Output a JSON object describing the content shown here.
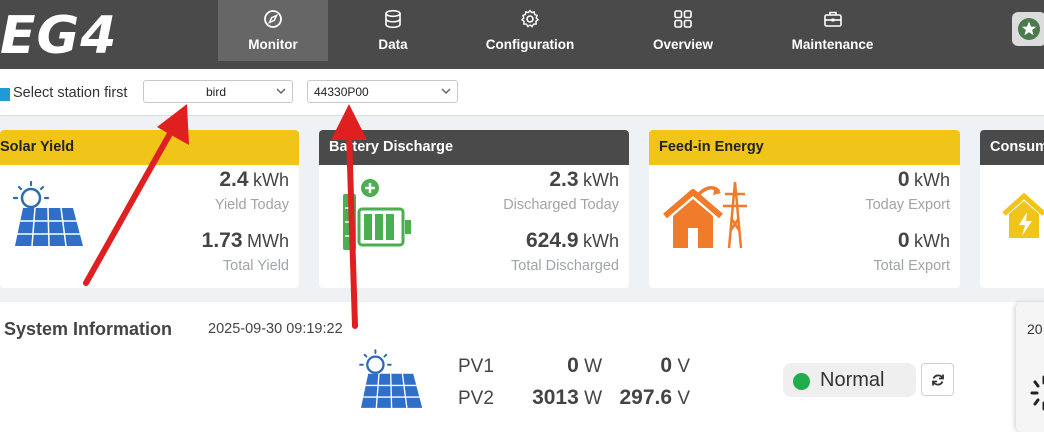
{
  "brand": {
    "logo_text": "EG4"
  },
  "nav": {
    "items": [
      {
        "label": "Monitor",
        "icon": "compass-icon",
        "active": true
      },
      {
        "label": "Data",
        "icon": "database-icon"
      },
      {
        "label": "Configuration",
        "icon": "gear-icon"
      },
      {
        "label": "Overview",
        "icon": "grid-icon"
      },
      {
        "label": "Maintenance",
        "icon": "toolbox-icon"
      }
    ],
    "star_icon": "star-icon"
  },
  "station": {
    "checkbox_label": "Select station first",
    "station_value": "bird",
    "serial_value": "44330P00"
  },
  "cards": {
    "solar": {
      "title": "Solar Yield",
      "a_value": "2.4",
      "a_unit": "kWh",
      "a_label": "Yield Today",
      "b_value": "1.73",
      "b_unit": "MWh",
      "b_label": "Total Yield"
    },
    "battery": {
      "title": "Battery Discharge",
      "a_value": "2.3",
      "a_unit": "kWh",
      "a_label": "Discharged Today",
      "b_value": "624.9",
      "b_unit": "kWh",
      "b_label": "Total Discharged"
    },
    "feedin": {
      "title": "Feed-in Energy",
      "a_value": "0",
      "a_unit": "kWh",
      "a_label": "Today Export",
      "b_value": "0",
      "b_unit": "kWh",
      "b_label": "Total Export"
    },
    "consumption": {
      "title": "Consum"
    }
  },
  "system": {
    "title": "System Information",
    "timestamp": "2025-09-30 09:19:22",
    "pv": [
      {
        "name": "PV1",
        "watts": "0",
        "w_unit": "W",
        "volts": "0",
        "v_unit": "V"
      },
      {
        "name": "PV2",
        "watts": "3013",
        "w_unit": "W",
        "volts": "297.6",
        "v_unit": "V"
      }
    ],
    "status": "Normal",
    "side_text": "20"
  },
  "colors": {
    "topbar": "#4a4a4a",
    "accent_yellow": "#f0c419",
    "status_green": "#1fae4b",
    "annotation_red": "#e02020"
  }
}
